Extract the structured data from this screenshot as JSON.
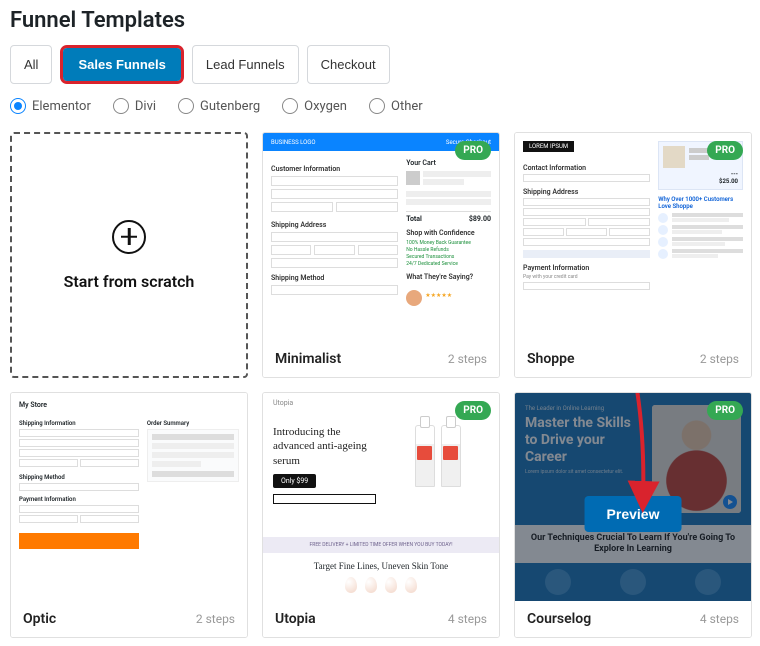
{
  "page_title": "Funnel Templates",
  "tabs": {
    "all": "All",
    "sales": "Sales Funnels",
    "lead": "Lead Funnels",
    "checkout": "Checkout"
  },
  "builders": {
    "elementor": "Elementor",
    "divi": "Divi",
    "gutenberg": "Gutenberg",
    "oxygen": "Oxygen",
    "other": "Other"
  },
  "scratch": {
    "label": "Start from scratch"
  },
  "badges": {
    "pro": "PRO"
  },
  "templates": {
    "minimalist": {
      "name": "Minimalist",
      "steps": "2 steps"
    },
    "shoppe": {
      "name": "Shoppe",
      "steps": "2 steps"
    },
    "optic": {
      "name": "Optic",
      "steps": "2 steps"
    },
    "utopia": {
      "name": "Utopia",
      "steps": "4 steps"
    },
    "courselog": {
      "name": "Courselog",
      "steps": "4 steps"
    }
  },
  "preview_btn": "Preview",
  "thumbnails": {
    "minimalist": {
      "header_left": "BUSINESS LOGO",
      "header_right": "Secure Checkout",
      "sect_customer": "Customer Information",
      "sect_shipping_addr": "Shipping Address",
      "sect_shipping_method": "Shipping Method",
      "cart_title": "Your Cart",
      "total_label": "Total",
      "total_value": "$89.00",
      "confidence": "Shop with Confidence",
      "guar1": "100% Money Back Guarantee",
      "guar2": "No Hassle Refunds",
      "guar3": "Secured Transactions",
      "guar4": "24/7 Dedicated Service",
      "testimonial_head": "What They're Saying?"
    },
    "shoppe": {
      "logo": "LOREM IPSUM",
      "sect_contact": "Contact Information",
      "sect_ship": "Shipping Address",
      "sect_pay": "Payment Information",
      "pay_note": "Pay with your credit card",
      "summary_price": "$25.00",
      "blue_head": "Why Over 1000+ Customers Love Shoppe"
    },
    "optic": {
      "brand": "My Store",
      "sect_ship_info": "Shipping Information",
      "sect_ship_method": "Shipping Method",
      "sect_pay": "Payment Information",
      "sect_order": "Order Summary"
    },
    "utopia": {
      "brand": "Utopia",
      "headline": "Introducing the advanced anti-ageing serum",
      "price_label": "Only $99",
      "banner": "FREE DELIVERY + LIMITED TIME OFFER WHEN YOU BUY TODAY!",
      "headline2": "Target Fine Lines, Uneven Skin Tone"
    },
    "courselog": {
      "kicker": "The Leader in Online Learning",
      "headline": "Master the Skills to Drive your Career",
      "white_headline": "Our Techniques Crucial To Learn If You're Going To Explore In Learning"
    }
  }
}
